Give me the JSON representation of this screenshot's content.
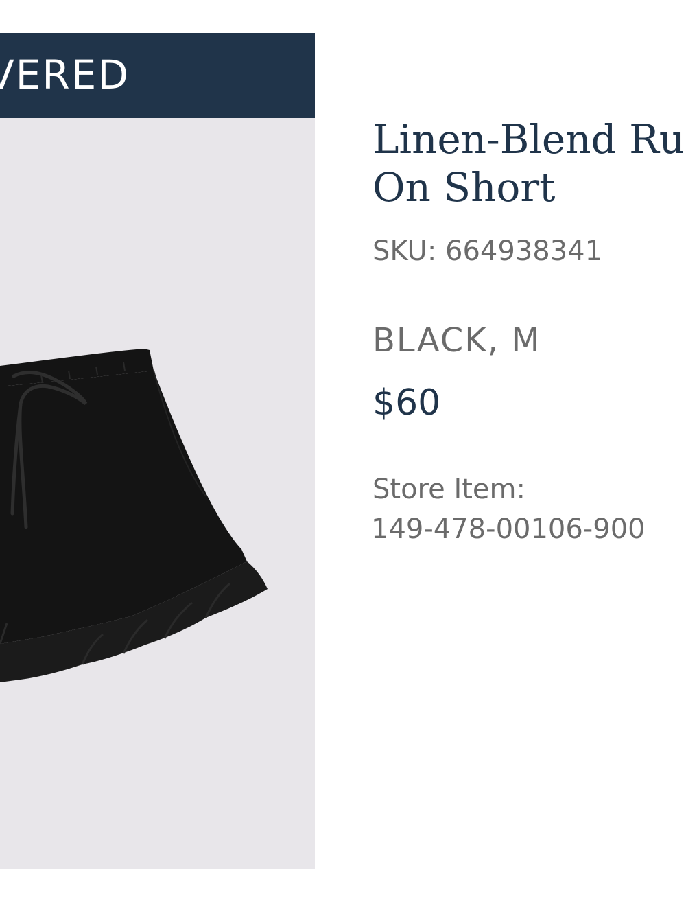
{
  "banner": {
    "text": "VERED"
  },
  "product": {
    "title_line1": "Linen-Blend Ruf",
    "title_line2": "On Short",
    "sku": "SKU: 664938341",
    "variant": "BLACK, M",
    "price": "$60",
    "store_item_label": "Store Item:",
    "store_item_value": "149-478-00106-900",
    "image_icon": "black-ruffle-shorts-image"
  },
  "colors": {
    "banner_bg": "#20344a",
    "photo_bg": "#e8e6ea",
    "title_text": "#20344a",
    "meta_text": "#6b6b6b",
    "garment": "#141414"
  }
}
